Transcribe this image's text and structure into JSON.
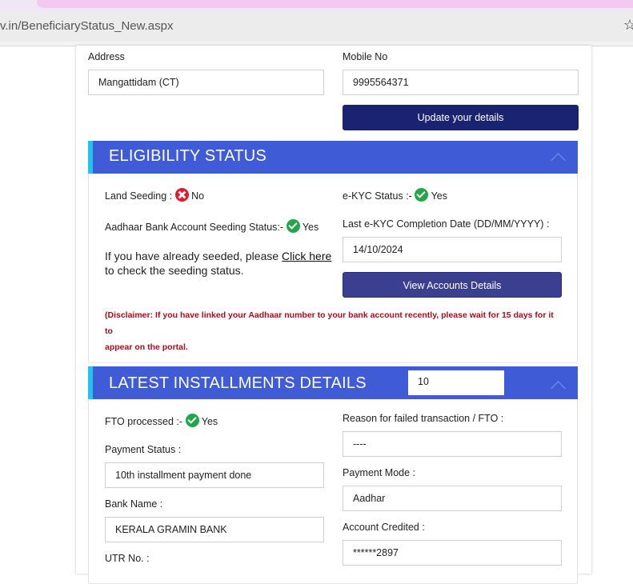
{
  "browser": {
    "url": "v.in/BeneficiaryStatus_New.aspx",
    "bookmark_icon": "star-icon"
  },
  "details": {
    "address_label": "Address",
    "address_value": "Mangattidam (CT)",
    "mobile_label": "Mobile No",
    "mobile_value": "9995564371",
    "update_button": "Update your details"
  },
  "eligibility": {
    "title": "ELIGIBILITY STATUS",
    "land_seeding_label": "Land Seeding :",
    "land_seeding_value": "No",
    "ekyc_label": "e-KYC Status :-",
    "ekyc_value": "Yes",
    "aadhaar_seeding_label": "Aadhaar Bank Account Seeding Status:-",
    "aadhaar_seeding_value": "Yes",
    "ekyc_date_label": "Last e-KYC Completion Date (DD/MM/YYYY) :",
    "ekyc_date_value": "14/10/2024",
    "help_prefix": "If you have already seeded, please",
    "help_link": "Click here",
    "help_suffix": "to check the seeding status.",
    "view_accounts_button": "View Accounts Details",
    "disclaimer_line1": "(Disclaimer: If you have linked your Aadhaar number to your bank account recently, please wait for 15 days for it to",
    "disclaimer_line2": "appear on the portal."
  },
  "installments": {
    "title": "LATEST INSTALLMENTS DETAILS",
    "selected_installment": "10",
    "fto_label": "FTO processed :-",
    "fto_value": "Yes",
    "reason_label": "Reason for failed transaction / FTO :",
    "reason_value": "----",
    "payment_status_label": "Payment Status :",
    "payment_status_value": "10th installment payment done",
    "payment_mode_label": "Payment Mode :",
    "payment_mode_value": "Aadhar",
    "bank_name_label": "Bank Name :",
    "bank_name_value": "KERALA GRAMIN BANK",
    "account_credited_label": "Account Credited :",
    "account_credited_value": "******2897",
    "utr_label": "UTR No. :"
  },
  "colors": {
    "section_header": "#3f5bd6",
    "section_accent": "#27c0f0",
    "primary_button": "#1a2370",
    "secondary_button": "#3b3f8f",
    "success": "#22a64a",
    "error": "#e0192b",
    "disclaimer": "#a0121c"
  }
}
